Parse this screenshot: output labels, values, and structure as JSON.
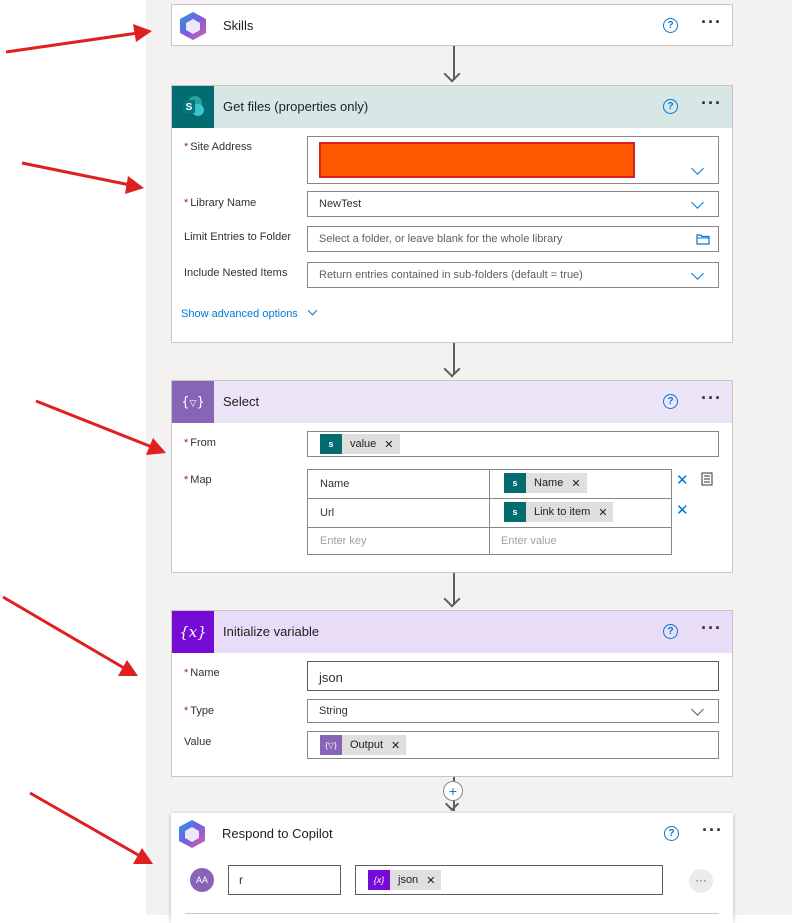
{
  "skills": {
    "title": "Skills"
  },
  "get_files": {
    "title": "Get files (properties only)",
    "site_address_label": "Site Address",
    "library_name_label": "Library Name",
    "library_name_value": "NewTest",
    "limit_label": "Limit Entries to Folder",
    "limit_placeholder": "Select a folder, or leave blank for the whole library",
    "nested_label": "Include Nested Items",
    "nested_placeholder": "Return entries contained in sub-folders (default = true)",
    "advanced": "Show advanced options"
  },
  "select": {
    "title": "Select",
    "from_label": "From",
    "from_token": "value",
    "map_label": "Map",
    "rows": [
      {
        "key": "Name",
        "value": "Name"
      },
      {
        "key": "Url",
        "value": "Link to item"
      }
    ],
    "enter_key": "Enter key",
    "enter_value": "Enter value"
  },
  "init_var": {
    "title": "Initialize variable",
    "name_label": "Name",
    "name_value": "json",
    "type_label": "Type",
    "type_value": "String",
    "value_label": "Value",
    "value_token": "Output"
  },
  "respond": {
    "title": "Respond to Copilot",
    "avatar": "AA",
    "input_value": "r",
    "token": "json"
  },
  "colors": {
    "accent": "#0078d4",
    "arrow": "#e02020",
    "sharepoint": "#036c70",
    "select": "#8764b8",
    "variable": "#770bd6",
    "redacted": "#ff5a00"
  }
}
